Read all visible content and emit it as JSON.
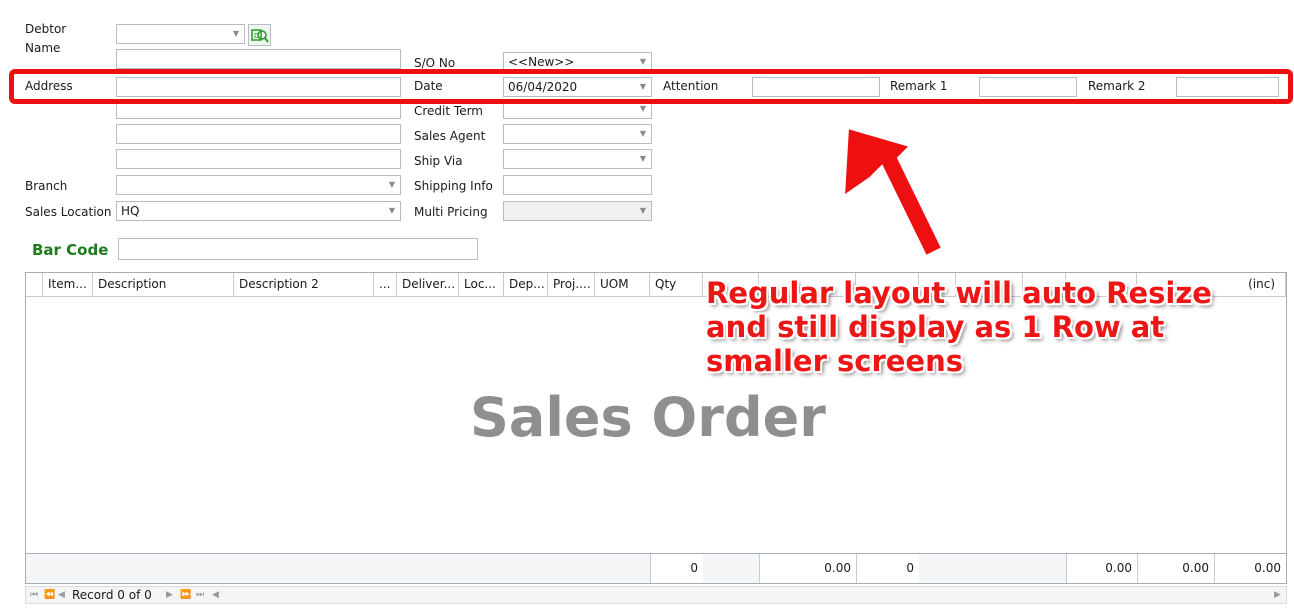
{
  "form": {
    "debtor_label": "Debtor",
    "name_label": "Name",
    "address_label": "Address",
    "branch_label": "Branch",
    "branch_value": "",
    "sales_location_label": "Sales Location",
    "sales_location_value": "HQ",
    "so_no_label": "S/O No",
    "so_no_value": "<<New>>",
    "date_label": "Date",
    "date_value": "06/04/2020",
    "credit_term_label": "Credit Term",
    "sales_agent_label": "Sales Agent",
    "ship_via_label": "Ship Via",
    "shipping_info_label": "Shipping Info",
    "multi_pricing_label": "Multi Pricing",
    "attention_label": "Attention",
    "remark1_label": "Remark 1",
    "remark2_label": "Remark 2",
    "bar_code_label": "Bar Code"
  },
  "grid": {
    "columns": [
      "Item...",
      "Description",
      "Description 2",
      "...",
      "Deliver...",
      "Loc...",
      "Dep...",
      "Proj....",
      "UOM",
      "Qty",
      "",
      "",
      "",
      "",
      "",
      "",
      "",
      "(inc)"
    ],
    "footer": [
      "0",
      "0.00",
      "0",
      "0.00",
      "0.00",
      "0.00"
    ],
    "watermark": "Sales Order"
  },
  "navigator": {
    "record_text": "Record 0 of 0"
  },
  "annotation": {
    "lines": [
      "Regular layout will auto Resize",
      "and still display as 1 Row at",
      "smaller screens"
    ]
  },
  "colors": {
    "highlight": "#ee1010",
    "annotation_text": "#ee1515",
    "bar_code_label": "#1e7a1e",
    "watermark": "#8f8f8f"
  },
  "icons": {
    "dropdown": "chevron-down-icon",
    "debtor_lookup": "search-debtor-icon",
    "nav_first": "first-record-icon",
    "nav_prev_page": "previous-page-icon",
    "nav_prev": "previous-record-icon",
    "nav_next": "next-record-icon",
    "nav_next_page": "next-page-icon",
    "nav_last": "last-record-icon"
  }
}
